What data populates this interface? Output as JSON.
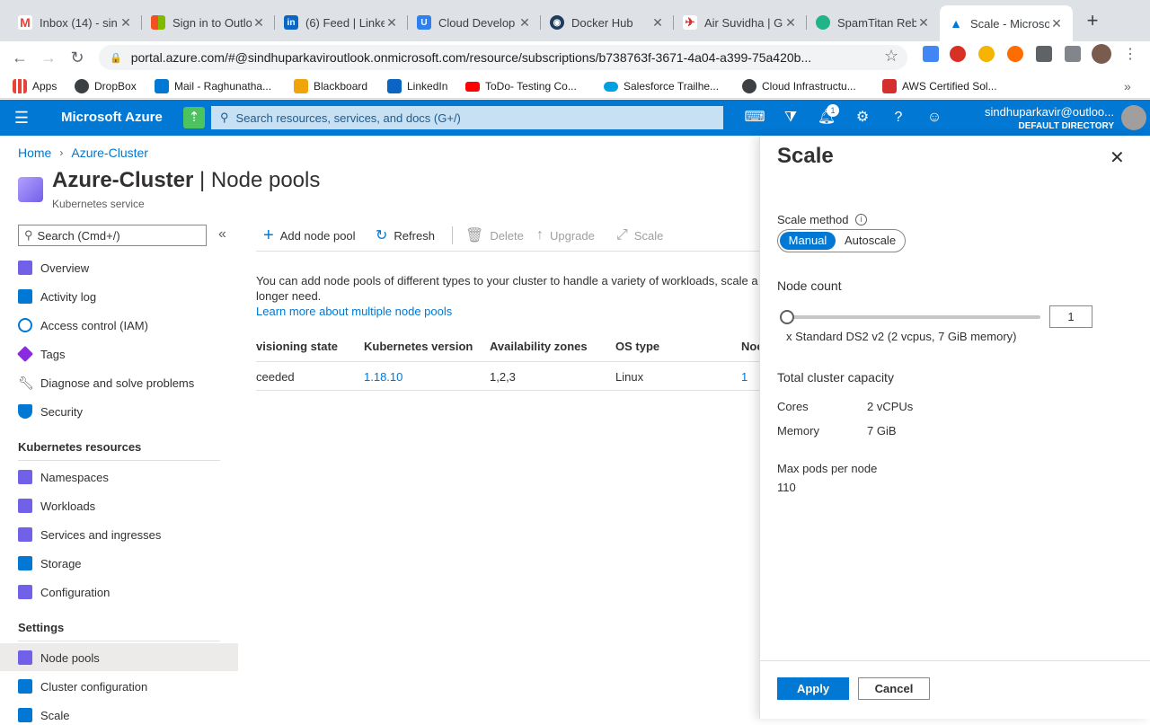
{
  "browser": {
    "tabs": [
      {
        "title": "Inbox (14) - sin",
        "icon": "gmail-icon",
        "color": "#ea4335"
      },
      {
        "title": "Sign in to Outlo",
        "icon": "microsoft-icon",
        "color": "#f25022"
      },
      {
        "title": "(6) Feed | Linke",
        "icon": "linkedin-icon",
        "color": "#0a66c2"
      },
      {
        "title": "Cloud Develop",
        "icon": "cloud-icon",
        "color": "#2f80ed"
      },
      {
        "title": "Docker Hub",
        "icon": "docker-icon",
        "color": "#1d63ed"
      },
      {
        "title": "Air Suvidha | G",
        "icon": "plane-icon",
        "color": "#d32f2f"
      },
      {
        "title": "SpamTitan Reb",
        "icon": "spamtitan-icon",
        "color": "#20b486"
      },
      {
        "title": "Scale - Microso",
        "icon": "azure-icon",
        "color": "#0078d4"
      }
    ],
    "url": "portal.azure.com/#@sindhuparkaviroutlook.onmicrosoft.com/resource/subscriptions/b738763f-3671-4a04-a399-75a420b...",
    "bookmarks": [
      {
        "label": "Apps",
        "icon": "apps-grid-icon",
        "color": "#ea4335"
      },
      {
        "label": "DropBox",
        "icon": "dropbox-icon",
        "color": "#3c4043"
      },
      {
        "label": "Mail - Raghunatha...",
        "icon": "outlook-icon",
        "color": "#0078d4"
      },
      {
        "label": "Blackboard",
        "icon": "blackboard-icon",
        "color": "#f0a30a"
      },
      {
        "label": "LinkedIn",
        "icon": "linkedin-icon",
        "color": "#0a66c2"
      },
      {
        "label": "ToDo- Testing Co...",
        "icon": "youtube-icon",
        "color": "#ff0000"
      },
      {
        "label": "Salesforce Trailhe...",
        "icon": "salesforce-icon",
        "color": "#00a1e0"
      },
      {
        "label": "Cloud Infrastructu...",
        "icon": "globe-icon",
        "color": "#3c4043"
      },
      {
        "label": "AWS Certified Sol...",
        "icon": "aws-icon",
        "color": "#d32f2f"
      }
    ]
  },
  "azure": {
    "brand": "Microsoft Azure",
    "search_placeholder": "Search resources, services, and docs (G+/)",
    "notification_count": "1",
    "user_email": "sindhuparkavir@outloo...",
    "directory": "DEFAULT DIRECTORY"
  },
  "breadcrumb": [
    "Home",
    "Azure-Cluster"
  ],
  "page": {
    "title_bold": "Azure-Cluster",
    "title_rest": " | Node pools",
    "subtitle": "Kubernetes service"
  },
  "sidebar": {
    "search_placeholder": "Search (Cmd+/)",
    "items_top": [
      {
        "label": "Overview",
        "icon": "overview-icon",
        "color": "#7160e8"
      },
      {
        "label": "Activity log",
        "icon": "activity-log-icon",
        "color": "#0078d4"
      },
      {
        "label": "Access control (IAM)",
        "icon": "iam-icon",
        "color": "#0078d4"
      },
      {
        "label": "Tags",
        "icon": "tag-icon",
        "color": "#8a2be2"
      },
      {
        "label": "Diagnose and solve problems",
        "icon": "wrench-icon",
        "color": "#605e5c"
      },
      {
        "label": "Security",
        "icon": "shield-icon",
        "color": "#0078d4"
      }
    ],
    "section_k8s": "Kubernetes resources",
    "items_k8s": [
      {
        "label": "Namespaces",
        "icon": "namespaces-icon",
        "color": "#7160e8"
      },
      {
        "label": "Workloads",
        "icon": "workloads-icon",
        "color": "#7160e8"
      },
      {
        "label": "Services and ingresses",
        "icon": "services-icon",
        "color": "#7160e8"
      },
      {
        "label": "Storage",
        "icon": "storage-icon",
        "color": "#0078d4"
      },
      {
        "label": "Configuration",
        "icon": "configuration-icon",
        "color": "#7160e8"
      }
    ],
    "section_settings": "Settings",
    "items_settings": [
      {
        "label": "Node pools",
        "icon": "node-pools-icon",
        "color": "#7160e8",
        "selected": true
      },
      {
        "label": "Cluster configuration",
        "icon": "cluster-config-icon",
        "color": "#0078d4"
      },
      {
        "label": "Scale",
        "icon": "scale-icon",
        "color": "#0078d4"
      }
    ]
  },
  "commands": {
    "add": "Add node pool",
    "refresh": "Refresh",
    "delete": "Delete",
    "upgrade": "Upgrade",
    "scale": "Scale"
  },
  "info": {
    "text1": "You can add node pools of different types to your cluster to handle a variety of workloads, scale a",
    "text2": "longer need.",
    "link": "Learn more about multiple node pools"
  },
  "table": {
    "headers": [
      "visioning state",
      "Kubernetes version",
      "Availability zones",
      "OS type",
      "Noc"
    ],
    "row": [
      "ceeded",
      "1.18.10",
      "1,2,3",
      "Linux",
      "1"
    ]
  },
  "scale_panel": {
    "title": "Scale",
    "method_label": "Scale method",
    "method_options": [
      "Manual",
      "Autoscale"
    ],
    "selected_method": "Manual",
    "node_count_label": "Node count",
    "node_count_value": "1",
    "vm_size_text": "x Standard DS2 v2 (2 vcpus, 7 GiB memory)",
    "capacity_title": "Total cluster capacity",
    "cores_label": "Cores",
    "cores_value": "2 vCPUs",
    "memory_label": "Memory",
    "memory_value": "7 GiB",
    "maxpods_label": "Max pods per node",
    "maxpods_value": "110",
    "apply_label": "Apply",
    "cancel_label": "Cancel"
  }
}
